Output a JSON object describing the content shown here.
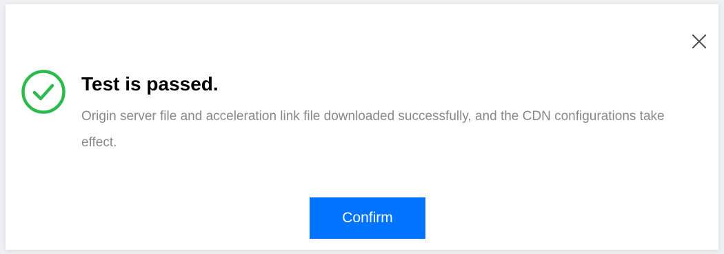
{
  "dialog": {
    "title": "Test is passed.",
    "message": "Origin server file and acceleration link file downloaded successfully, and the CDN configurations take effect.",
    "confirm_label": "Confirm",
    "status_icon": "check-circle-icon",
    "close_icon": "close-icon"
  },
  "colors": {
    "success": "#2bba4b",
    "primary": "#0073ff",
    "message_text": "#888888",
    "close_icon": "#555555"
  }
}
